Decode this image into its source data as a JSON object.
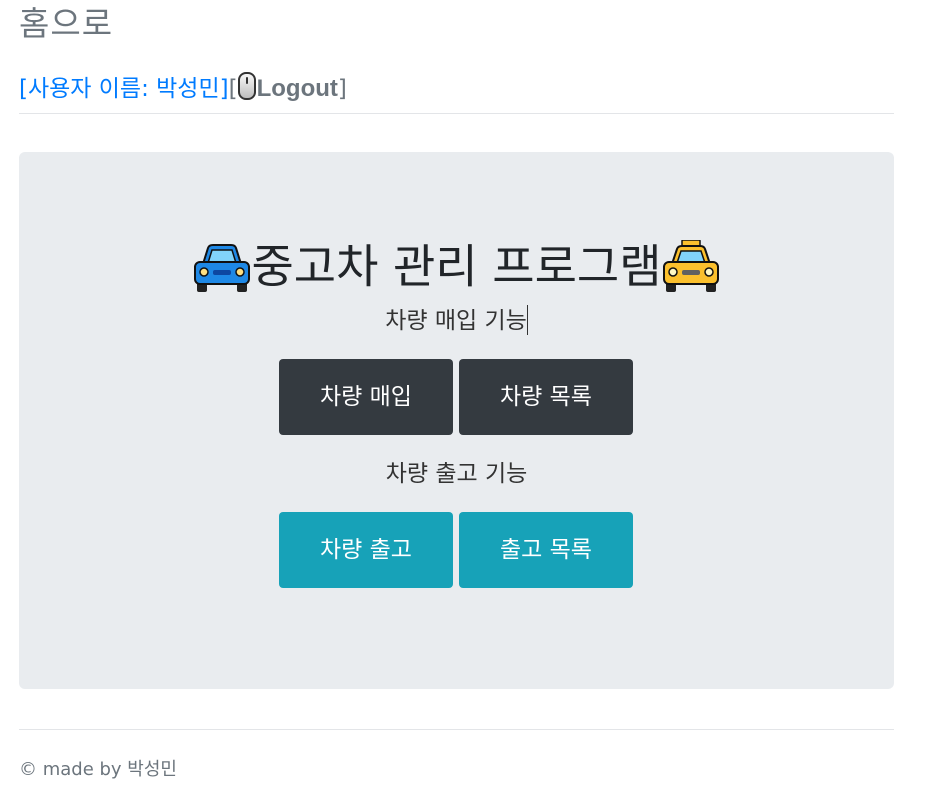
{
  "nav": {
    "home_link": "홈으로"
  },
  "user_bar": {
    "user_label": "[사용자 이름: 박성민]",
    "bracket_open": "[",
    "logout_label": "Logout",
    "bracket_close": "]",
    "logout_icon": "computer-mouse-icon"
  },
  "main": {
    "title": "중고차 관리 프로그램",
    "title_left_icon": "blue-car-icon",
    "title_right_icon": "taxi-icon",
    "purchase_section_label": "차량 매입 기능",
    "purchase_buttons": [
      "차량 매입",
      "차량 목록"
    ],
    "release_section_label": "차량 출고 기능",
    "release_buttons": [
      "차량 출고",
      "출고 목록"
    ]
  },
  "footer": {
    "text": "© made by 박성민"
  },
  "colors": {
    "primary_link": "#007bff",
    "muted": "#6c757d",
    "jumbotron_bg": "#e9ecef",
    "btn_dark": "#343a40",
    "btn_info": "#17a2b8"
  }
}
